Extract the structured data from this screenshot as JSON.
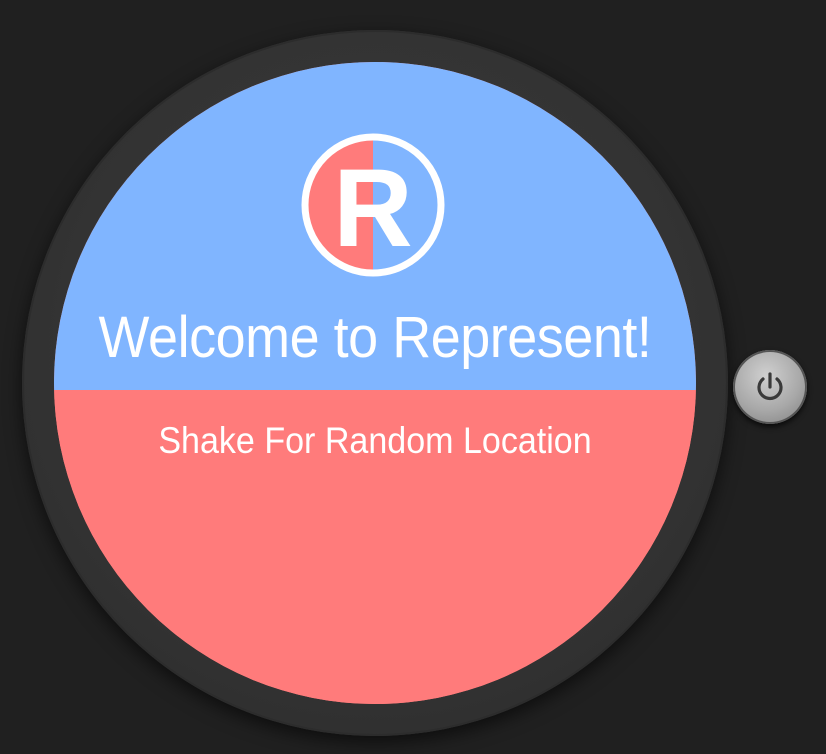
{
  "watch": {
    "logo_letter": "R",
    "welcome_text": "Welcome to Represent!",
    "shake_text": "Shake For Random Location"
  },
  "colors": {
    "background": "#202020",
    "bezel": "#333333",
    "top_half": "#80b5ff",
    "bottom_half": "#ff7b7b",
    "text": "#ffffff"
  },
  "icons": {
    "logo": "represent-r-logo-icon",
    "power": "power-icon"
  }
}
